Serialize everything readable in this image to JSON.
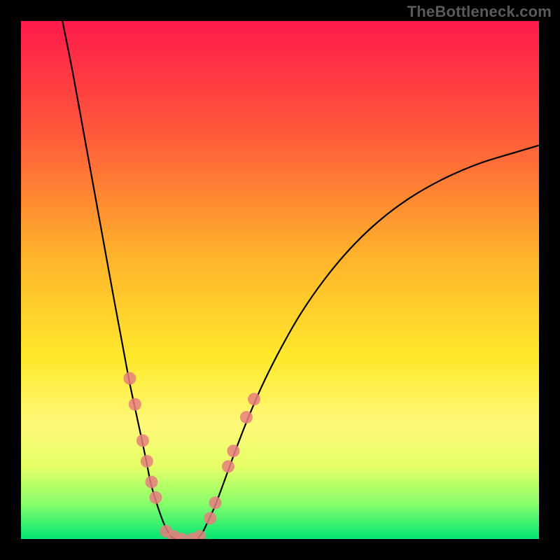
{
  "watermark": "TheBottleneck.com",
  "chart_data": {
    "type": "line",
    "title": "",
    "xlabel": "",
    "ylabel": "",
    "xlim": [
      0,
      100
    ],
    "ylim": [
      0,
      100
    ],
    "background_gradient": {
      "stops": [
        {
          "offset": 0.0,
          "color": "#ff1a4b"
        },
        {
          "offset": 0.22,
          "color": "#ff5a3a"
        },
        {
          "offset": 0.45,
          "color": "#ffb22b"
        },
        {
          "offset": 0.65,
          "color": "#ffe92b"
        },
        {
          "offset": 0.78,
          "color": "#fff97a"
        },
        {
          "offset": 0.86,
          "color": "#e6ff66"
        },
        {
          "offset": 0.93,
          "color": "#8bff6a"
        },
        {
          "offset": 1.0,
          "color": "#00e673"
        }
      ]
    },
    "series": [
      {
        "name": "left-branch",
        "type": "curve",
        "stroke": "#000000",
        "x": [
          8,
          10,
          12,
          14,
          16,
          18,
          19.5,
          21,
          22.5,
          24,
          25,
          26,
          27,
          27.8,
          28.5,
          29.2,
          30
        ],
        "y": [
          100,
          90,
          79,
          68,
          57,
          46,
          38,
          30,
          23,
          16,
          11,
          7.5,
          4.5,
          2.5,
          1.2,
          0.3,
          0
        ]
      },
      {
        "name": "right-branch",
        "type": "curve",
        "stroke": "#000000",
        "x": [
          34,
          35,
          36,
          37.5,
          39,
          41,
          43.5,
          46.5,
          50,
          54,
          58.5,
          63.5,
          69,
          75,
          81.5,
          88.5,
          96,
          100
        ],
        "y": [
          0,
          1.2,
          3.2,
          6.5,
          10.5,
          16,
          22.5,
          29.5,
          36.5,
          43.5,
          50,
          56,
          61.3,
          65.8,
          69.5,
          72.5,
          74.8,
          76
        ]
      }
    ],
    "scatter": {
      "name": "dots",
      "color": "#e77e7e",
      "radius": 9,
      "points": [
        {
          "x": 21.0,
          "y": 31.0
        },
        {
          "x": 22.0,
          "y": 26.0
        },
        {
          "x": 23.5,
          "y": 19.0
        },
        {
          "x": 24.3,
          "y": 15.0
        },
        {
          "x": 25.2,
          "y": 11.0
        },
        {
          "x": 26.0,
          "y": 8.0
        },
        {
          "x": 28.0,
          "y": 1.5
        },
        {
          "x": 29.5,
          "y": 0.5
        },
        {
          "x": 31.0,
          "y": 0.0
        },
        {
          "x": 33.0,
          "y": 0.0
        },
        {
          "x": 34.5,
          "y": 0.5
        },
        {
          "x": 36.5,
          "y": 4.0
        },
        {
          "x": 37.5,
          "y": 7.0
        },
        {
          "x": 40.0,
          "y": 14.0
        },
        {
          "x": 41.0,
          "y": 17.0
        },
        {
          "x": 43.5,
          "y": 23.5
        },
        {
          "x": 45.0,
          "y": 27.0
        }
      ]
    }
  }
}
